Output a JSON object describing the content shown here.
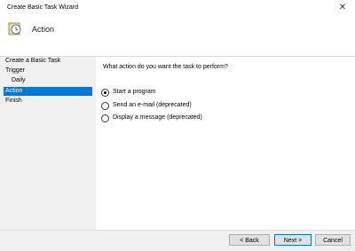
{
  "window": {
    "title": "Create Basic Task Wizard"
  },
  "header": {
    "title": "Action",
    "icon": "task-scheduler-icon"
  },
  "sidebar": {
    "items": [
      {
        "label": "Create a Basic Task"
      },
      {
        "label": "Trigger"
      },
      {
        "label": "Daily"
      },
      {
        "label": "Action"
      },
      {
        "label": "Finish"
      }
    ],
    "selected": "Action"
  },
  "content": {
    "question": "What action do you want the task to perform?",
    "options": [
      {
        "label": "Start a program",
        "checked": true
      },
      {
        "label": "Send an e-mail (deprecated)",
        "checked": false
      },
      {
        "label": "Display a message (deprecated)",
        "checked": false
      }
    ]
  },
  "footer": {
    "back_label": "< Back",
    "next_label": "Next >",
    "cancel_label": "Cancel"
  },
  "colors": {
    "selection": "#0078d7",
    "window_bg": "#f0f0f0"
  }
}
